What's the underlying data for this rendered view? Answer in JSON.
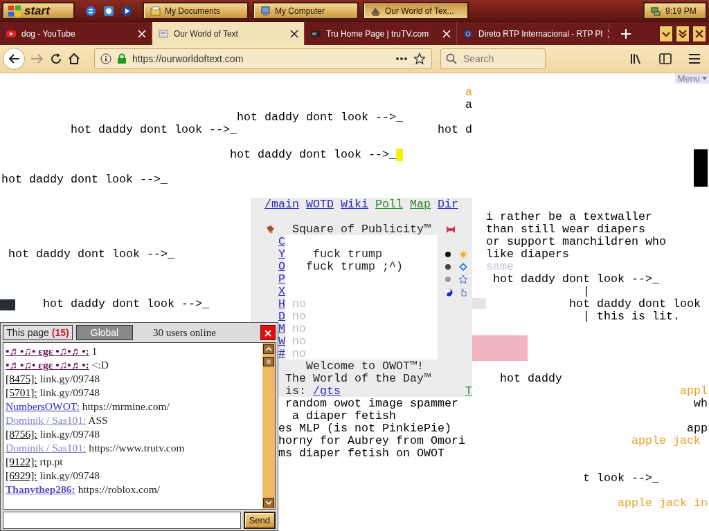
{
  "taskbar": {
    "start": "start",
    "tasks": [
      {
        "label": "My Documents",
        "selected": false
      },
      {
        "label": "My Computer",
        "selected": false
      },
      {
        "label": "Our World of Tex...",
        "selected": true
      }
    ],
    "clock": "9:19 PM"
  },
  "tabs": [
    {
      "title": "dog - YouTube",
      "selected": false
    },
    {
      "title": "Our World of Text",
      "selected": true
    },
    {
      "title": "Tru Home Page | truTV.com",
      "selected": false
    },
    {
      "title": "Direto RTP Internacional - RTP Pl",
      "selected": false
    }
  ],
  "toolbar": {
    "forward_disabled": true,
    "url": "https://ourworldoftext.com",
    "search_placeholder": "Search"
  },
  "page": {
    "menu_button": "Menu",
    "texts": [
      {
        "text": "a",
        "color": "#e8a020"
      },
      {
        "text": "a"
      },
      {
        "text": "hot daddy dont look -->_"
      },
      {
        "text": "hot daddy dont look -->_"
      },
      {
        "text": "hot d"
      },
      {
        "text": "hot daddy dont look -->_"
      },
      {
        "text": "hot daddy dont look -->_"
      },
      {
        "text": "i rather be a textwaller"
      },
      {
        "text": "than still wear diapers"
      },
      {
        "text": "or support manchildren who"
      },
      {
        "text": "like diapers"
      },
      {
        "text": "same",
        "color": "#c4c4e4"
      },
      {
        "text": "hot daddy dont look -->_"
      },
      {
        "text": "hot daddy dont look -->_"
      },
      {
        "text": "|"
      },
      {
        "text": "hot daddy dont look"
      },
      {
        "text": "| this is lit."
      },
      {
        "text": "hot daddy dont look -->_"
      },
      {
        "text": "hot daddy"
      },
      {
        "text": "appl",
        "color": "#e8a020"
      },
      {
        "text": "wh"
      },
      {
        "text": "app"
      },
      {
        "text": "apple jack",
        "color": "#e8a020"
      },
      {
        "text": "t look -->_"
      },
      {
        "text": "apple jack in",
        "color": "#e8a020"
      },
      {
        "text": "random owot image spammer"
      },
      {
        "text": "a diaper fetish"
      },
      {
        "text": "es MLP (is not PinkiePie)"
      },
      {
        "text": "horny for Aubrey from Omori"
      },
      {
        "text": "ms diaper fetish on OWOT"
      }
    ],
    "panel": {
      "links": [
        {
          "text": "/main",
          "color": "#2a2ac0"
        },
        {
          "text": "WOTD",
          "color": "#2a2ac0"
        },
        {
          "text": "Wiki",
          "color": "#2a2ac0"
        },
        {
          "text": "Poll",
          "color": "#2a8a2a"
        },
        {
          "text": "Map",
          "color": "#2a8a2a"
        },
        {
          "text": "Dir",
          "color": "#2a2ac0"
        }
      ],
      "title": "Square of Publicity™",
      "letters": [
        "C",
        "Y",
        "O",
        "P",
        "X",
        "H",
        "D",
        "M",
        "W",
        "#"
      ],
      "messages": [
        "fuck trump",
        "fuck trump ;^)"
      ],
      "entries": [
        "no",
        "no",
        "no",
        "no",
        "no"
      ],
      "welcome": "Welcome to OWOT™!",
      "wotd_label": "The World of the Day™",
      "wotd_prefix": "is:",
      "wotd_link": "/gts",
      "corner_link": "T"
    }
  },
  "chat": {
    "tabs": [
      {
        "label": "This page",
        "count": "(15)",
        "selected": true
      },
      {
        "label": "Global",
        "selected": false
      }
    ],
    "online": "30 users online",
    "messages": [
      {
        "nick": "•♬•♫• εgε •♫•♬•:",
        "text": "1",
        "color": "#6a1050",
        "bold": true
      },
      {
        "nick": "•♬•♫• εgε •♫•♬•:",
        "text": "<:D",
        "color": "#6a1050",
        "bold": true
      },
      {
        "nick": "[8475]:",
        "text": "link.gy/09748",
        "color": "#000000",
        "bold": false
      },
      {
        "nick": "[5701]:",
        "text": "link.gy/09748",
        "color": "#000000",
        "bold": false
      },
      {
        "nick": "NumbersOWOT:",
        "text": "https://mrmine.com/",
        "color": "#2a2ad0",
        "bold": false
      },
      {
        "nick": "Dominik / Sas101:",
        "text": "ASS",
        "color": "#8080d0",
        "bold": false
      },
      {
        "nick": "[8756]:",
        "text": "link.gy/09748",
        "color": "#000000",
        "bold": false
      },
      {
        "nick": "Dominik / Sas101:",
        "text": "https://www.trutv.com",
        "color": "#8080d0",
        "bold": false
      },
      {
        "nick": "[9122]:",
        "text": "rtp.pt",
        "color": "#000000",
        "bold": false
      },
      {
        "nick": "[6929]:",
        "text": "link.gy/09748",
        "color": "#000000",
        "bold": false
      },
      {
        "nick": "Thanythep286:",
        "text": "https://roblox.com/",
        "color": "#5a4fcf",
        "bold": true
      }
    ],
    "send": "Send"
  }
}
